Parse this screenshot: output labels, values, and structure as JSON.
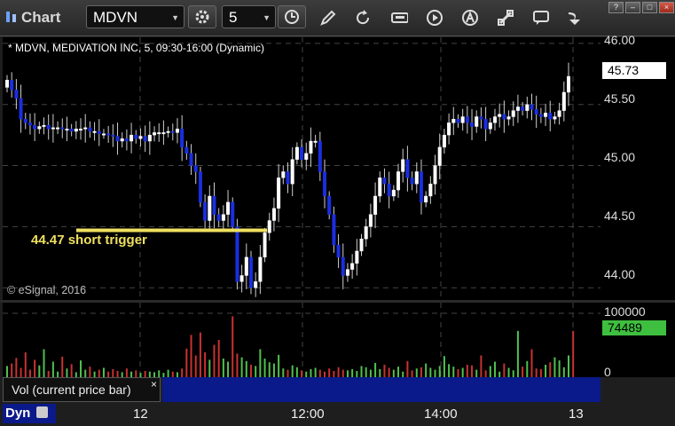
{
  "app": {
    "title": "Chart"
  },
  "toolbar": {
    "symbol": "MDVN",
    "interval": "5"
  },
  "chart": {
    "header": "* MDVN, MEDIVATION INC, 5, 09:30-16:00 (Dynamic)",
    "copyright": "© eSignal, 2016",
    "annotation": "44.47 short trigger",
    "annotation_color": "#f0e060",
    "last_price": "45.73",
    "price_ticks": [
      "46.00",
      "45.50",
      "45.00",
      "44.50",
      "44.00"
    ],
    "volume_ticks": [
      "100000",
      "0"
    ],
    "last_volume": "74489",
    "volume_label": "Vol (current price bar)",
    "volume_label_close": "×",
    "time_ticks": [
      "12",
      "12:00",
      "14:00",
      "13"
    ],
    "mode": "Dyn",
    "up_color": "#ffffff",
    "down_color": "#1a2fe0"
  },
  "chart_data": {
    "type": "candlestick",
    "title": "* MDVN, MEDIVATION INC, 5, 09:30-16:00 (Dynamic)",
    "ylim": [
      43.9,
      46.05
    ],
    "y_ticks": [
      44.0,
      44.5,
      45.0,
      45.5,
      46.0
    ],
    "trigger_level": 44.47,
    "volume_ylim": [
      0,
      120000
    ],
    "volume_ticks": [
      0,
      100000
    ],
    "last_volume": 74489,
    "closes": [
      45.7,
      45.62,
      45.55,
      45.38,
      45.35,
      45.33,
      45.3,
      45.32,
      45.33,
      45.3,
      45.31,
      45.31,
      45.3,
      45.3,
      45.28,
      45.3,
      45.3,
      45.31,
      45.28,
      45.28,
      45.26,
      45.26,
      45.25,
      45.24,
      45.2,
      45.22,
      45.2,
      45.25,
      45.22,
      45.24,
      45.2,
      45.25,
      45.27,
      45.27,
      45.27,
      45.28,
      45.27,
      45.3,
      45.15,
      45.1,
      45.0,
      44.95,
      44.7,
      44.55,
      44.75,
      44.6,
      44.55,
      44.6,
      44.7,
      44.5,
      44.05,
      44.1,
      44.25,
      44.0,
      44.05,
      44.25,
      44.45,
      44.55,
      44.65,
      44.9,
      44.95,
      44.85,
      45.05,
      45.15,
      45.05,
      45.1,
      45.2,
      45.2,
      44.95,
      44.75,
      44.6,
      44.35,
      44.25,
      44.1,
      44.15,
      44.2,
      44.3,
      44.4,
      44.5,
      44.6,
      44.75,
      44.9,
      44.85,
      44.75,
      44.8,
      44.95,
      45.05,
      44.9,
      44.85,
      44.95,
      44.7,
      44.75,
      44.85,
      45.0,
      45.15,
      45.25,
      45.35,
      45.38,
      45.35,
      45.4,
      45.35,
      45.32,
      45.4,
      45.38,
      45.3,
      45.35,
      45.4,
      45.42,
      45.38,
      45.4,
      45.45,
      45.48,
      45.45,
      45.5,
      45.46,
      45.42,
      45.4,
      45.43,
      45.38,
      45.4,
      45.45,
      45.6,
      45.73
    ],
    "volumes": [
      18000,
      22000,
      31000,
      15000,
      40000,
      12000,
      28000,
      19000,
      45000,
      10000,
      25000,
      9000,
      33000,
      14000,
      21000,
      8000,
      27000,
      12000,
      17000,
      9000,
      12000,
      15000,
      9000,
      13000,
      10000,
      8000,
      14000,
      9000,
      11000,
      7000,
      10000,
      9000,
      8000,
      11000,
      7000,
      12000,
      9000,
      8000,
      14000,
      46000,
      68000,
      35000,
      72000,
      40000,
      28000,
      52000,
      60000,
      30000,
      25000,
      98000,
      38000,
      32000,
      26000,
      20000,
      18000,
      45000,
      30000,
      24000,
      22000,
      36000,
      14000,
      12000,
      19000,
      16000,
      11000,
      9000,
      13000,
      15000,
      12000,
      9000,
      14000,
      10000,
      16000,
      12000,
      11000,
      13000,
      10000,
      18000,
      16000,
      12000,
      23000,
      13000,
      20000,
      15000,
      12000,
      17000,
      9000,
      26000,
      11000,
      14000,
      16000,
      22000,
      15000,
      12000,
      18000,
      34000,
      21000,
      17000,
      13000,
      15000,
      20000,
      19000,
      12000,
      35000,
      11000,
      18000,
      25000,
      9000,
      22000,
      15000,
      11000,
      74489,
      17000,
      26000,
      45000,
      14000,
      13000,
      20000,
      24000,
      32000,
      27000,
      16000,
      35000,
      74489
    ]
  }
}
